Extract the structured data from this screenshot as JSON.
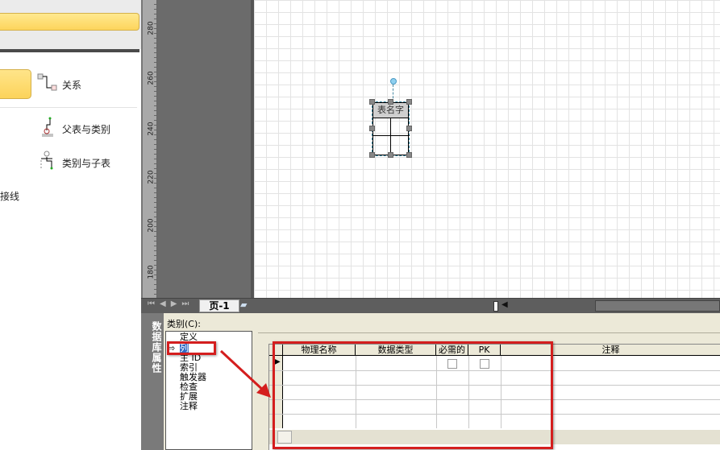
{
  "stencil": {
    "items": [
      {
        "label": "关系"
      },
      {
        "label": "父表与类别"
      },
      {
        "label": "类别与子表"
      },
      {
        "label": "接线"
      }
    ]
  },
  "ruler": {
    "labels": [
      "280",
      "260",
      "240",
      "220",
      "200",
      "180"
    ]
  },
  "shape": {
    "title": "表名字"
  },
  "tabs": {
    "page": "页-1"
  },
  "panel": {
    "title": "数据库属性",
    "category_label": "类别(C):",
    "categories": [
      "定义",
      "列",
      "主 ID",
      "索引",
      "触发器",
      "检查",
      "扩展",
      "注释"
    ],
    "selected": "列"
  },
  "grid": {
    "columns": [
      "物理名称",
      "数据类型",
      "必需的",
      "PK",
      "注释"
    ]
  },
  "colors": {
    "highlight": "#d41e1e"
  }
}
